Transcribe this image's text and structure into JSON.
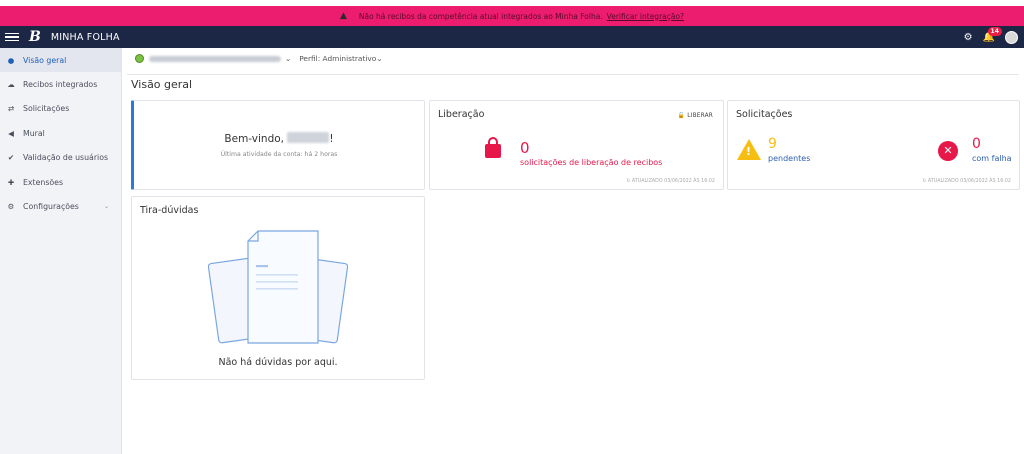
{
  "alert": {
    "text": "Não há recibos da competência atual integrados ao Minha Folha.",
    "link": "Verificar integração?"
  },
  "topbar": {
    "logo": "B",
    "app_title": "MINHA FOLHA",
    "notifications_count": "14"
  },
  "sidebar": {
    "items": [
      {
        "label": "Visão geral",
        "icon": "globe-icon"
      },
      {
        "label": "Recibos integrados",
        "icon": "cloud-upload-icon"
      },
      {
        "label": "Solicitações",
        "icon": "exchange-icon"
      },
      {
        "label": "Mural",
        "icon": "megaphone-icon"
      },
      {
        "label": "Validação de usuários",
        "icon": "check-icon"
      },
      {
        "label": "Extensões",
        "icon": "puzzle-icon"
      },
      {
        "label": "Configurações",
        "icon": "gears-icon"
      }
    ]
  },
  "filter": {
    "profile_label": "Perfil: Administrativo"
  },
  "page": {
    "title": "Visão geral"
  },
  "welcome": {
    "greeting_prefix": "Bem-vindo,",
    "greeting_suffix": "!",
    "last_activity": "Última atividade da conta: há 2 horas"
  },
  "liberacao": {
    "title": "Liberação",
    "action": "LIBERAR",
    "count": "0",
    "description": "solicitações de liberação de recibos",
    "updated": "ATUALIZADO 03/06/2022 ÀS 16:02"
  },
  "solicitacoes": {
    "title": "Solicitações",
    "pending_count": "9",
    "pending_label": "pendentes",
    "failed_count": "0",
    "failed_label": "com falha",
    "updated": "ATUALIZADO 03/06/2022 ÀS 16:02"
  },
  "faq": {
    "title": "Tira-dúvidas",
    "empty_message": "Não há dúvidas por aqui."
  },
  "colors": {
    "alert": "#ec1c6e",
    "topbar": "#1c2645",
    "accent": "#2b79d8",
    "danger": "#e8174a",
    "warning": "#f7be12"
  }
}
